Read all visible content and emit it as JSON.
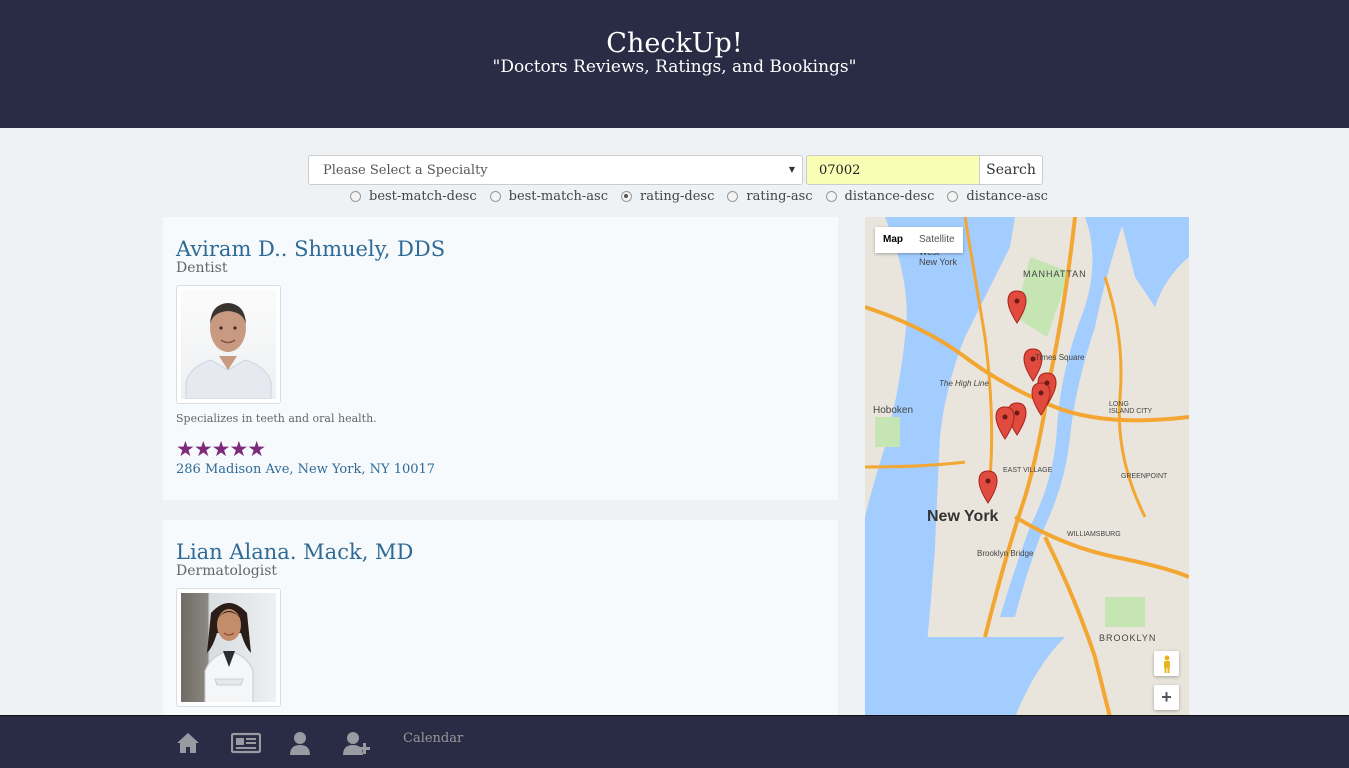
{
  "header": {
    "title": "CheckUp!",
    "subtitle": "\"Doctors Reviews, Ratings, and Bookings\""
  },
  "search": {
    "specialty_selected": "Please Select a Specialty",
    "zip_value": "07002",
    "button_label": "Search"
  },
  "sort_options": [
    {
      "label": "best-match-desc",
      "checked": false
    },
    {
      "label": "best-match-asc",
      "checked": false
    },
    {
      "label": "rating-desc",
      "checked": true
    },
    {
      "label": "rating-asc",
      "checked": false
    },
    {
      "label": "distance-desc",
      "checked": false
    },
    {
      "label": "distance-asc",
      "checked": false
    }
  ],
  "doctors": [
    {
      "name": "Aviram D.. Shmuely, DDS",
      "specialty": "Dentist",
      "description": "Specializes in teeth and oral health.",
      "rating": 5,
      "stars": "★★★★★",
      "address": "286 Madison Ave, New York, NY 10017"
    },
    {
      "name": "Lian Alana. Mack, MD",
      "specialty": "Dermatologist"
    }
  ],
  "map": {
    "tabs": [
      "Map",
      "Satellite"
    ],
    "active_tab": "Map",
    "labels": {
      "city": "New York",
      "manhattan": "MANHATTAN",
      "hoboken": "Hoboken",
      "brooklyn": "BROOKLYN",
      "west_ny": "West New York",
      "williamsburg": "WILLIAMSBURG",
      "brooklyn_bridge": "Brooklyn Bridge",
      "high_line": "The High Line",
      "times_square": "Times Square",
      "east_village": "EAST VILLAGE",
      "greenpoint": "GREENPOINT",
      "long_island_city": "LONG ISLAND CITY"
    },
    "zoom_in": "+"
  },
  "footer": {
    "calendar_label": "Calendar"
  },
  "colors": {
    "header_bg": "#2a2b45",
    "link": "#2f6a96",
    "stars": "#7d2a7a",
    "pin": "#e04a3f",
    "water": "#a3ccff",
    "highway": "#f3a632"
  }
}
